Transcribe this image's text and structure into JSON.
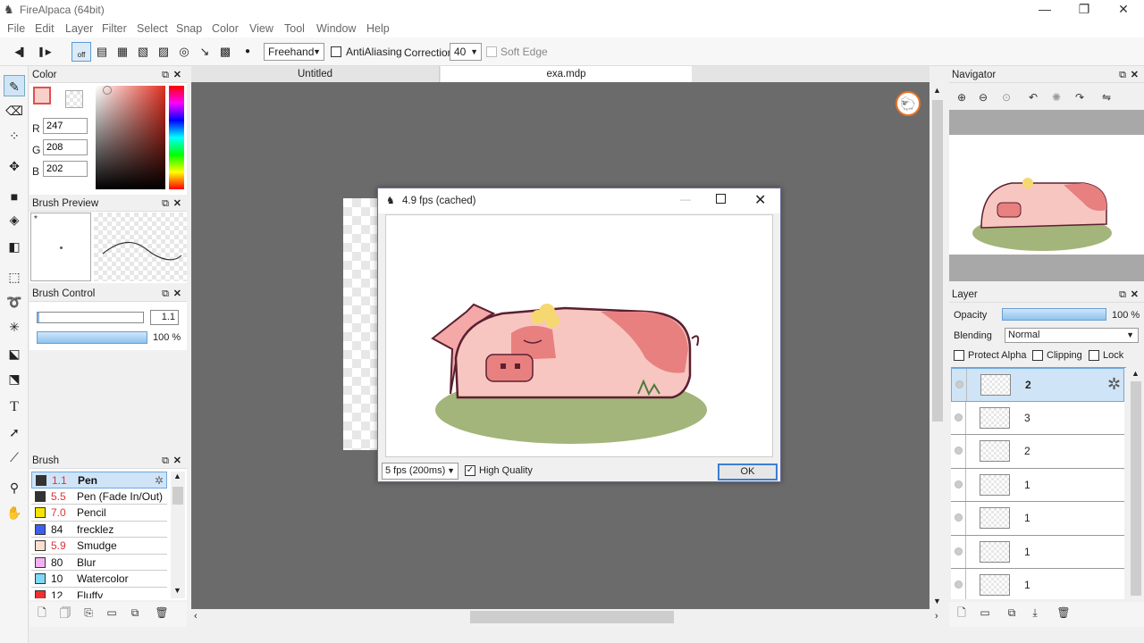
{
  "app": {
    "title": "FireAlpaca (64bit)"
  },
  "window_buttons": {
    "minimize": "—",
    "maximize": "❐",
    "close": "✕"
  },
  "menu": [
    "File",
    "Edit",
    "Layer",
    "Filter",
    "Select",
    "Snap",
    "Color",
    "View",
    "Tool",
    "Window",
    "Help"
  ],
  "toolbar": {
    "prev": "◀▌",
    "next": "▌▶",
    "snap_off": "off",
    "mode": "Freehand",
    "antialiasing": "AntiAliasing",
    "correction_label": "Correction",
    "correction_value": "40",
    "soft_edge": "Soft Edge"
  },
  "color_panel": {
    "title": "Color",
    "r_label": "R",
    "r": "247",
    "g_label": "G",
    "g": "208",
    "b_label": "B",
    "b": "202",
    "fg": "#f7d0ca"
  },
  "brush_preview": {
    "title": "Brush Preview",
    "marker": "*"
  },
  "brush_control": {
    "title": "Brush Control",
    "size": "1.1",
    "opacity": "100 %"
  },
  "brush_panel": {
    "title": "Brush",
    "items": [
      {
        "size": "1.1",
        "name": "Pen",
        "color": "#333333"
      },
      {
        "size": "5.5",
        "name": "Pen (Fade In/Out)",
        "color": "#333333"
      },
      {
        "size": "7.0",
        "name": "Pencil",
        "color": "#f5e400"
      },
      {
        "size": "84",
        "name": "frecklez",
        "color": "#3d5ef0"
      },
      {
        "size": "5.9",
        "name": "Smudge",
        "color": "#fbe0d0"
      },
      {
        "size": "80",
        "name": "Blur",
        "color": "#f3b0f0"
      },
      {
        "size": "10",
        "name": "Watercolor",
        "color": "#7fd8f7"
      },
      {
        "size": "12",
        "name": "Fluffy",
        "color": "#f03030"
      }
    ]
  },
  "tabs": [
    "Untitled",
    "exa.mdp"
  ],
  "dialog": {
    "title": "4.9 fps (cached)",
    "fps": "5 fps (200ms)",
    "high_quality": "High Quality",
    "ok": "OK"
  },
  "navigator": {
    "title": "Navigator"
  },
  "layer_panel": {
    "title": "Layer",
    "opacity_label": "Opacity",
    "opacity_value": "100 %",
    "blending_label": "Blending",
    "blending_value": "Normal",
    "protect_alpha": "Protect Alpha",
    "clipping": "Clipping",
    "lock": "Lock",
    "layers": [
      "2",
      "3",
      "2",
      "1",
      "1",
      "1",
      "1"
    ]
  }
}
